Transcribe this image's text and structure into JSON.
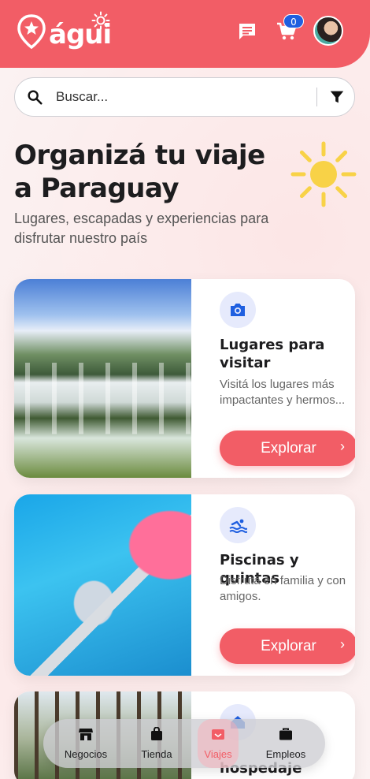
{
  "app": {
    "logo_text": "águi"
  },
  "header": {
    "cart_count": "0"
  },
  "search": {
    "placeholder": "Buscar..."
  },
  "hero": {
    "title": "Organizá tu viaje a Paraguay",
    "subtitle": "Lugares, escapadas y experiencias para disfrutar nuestro país"
  },
  "cards": [
    {
      "icon": "camera-icon",
      "title": "Lugares para visitar",
      "description": "Visitá los lugares más impactantes y hermos...",
      "button": "Explorar"
    },
    {
      "icon": "swimming-icon",
      "title": "Piscinas y quintas",
      "description": "Disfrutá en familia y con amigos.",
      "button": "Explorar"
    },
    {
      "icon": "lodging-icon",
      "title": "hospedaje"
    }
  ],
  "bottom_nav": {
    "items": [
      {
        "label": "Negocios",
        "icon": "store-icon"
      },
      {
        "label": "Tienda",
        "icon": "shopping-bag-icon"
      },
      {
        "label": "Viajes",
        "icon": "luggage-icon",
        "active": true
      },
      {
        "label": "Empleos",
        "icon": "briefcase-icon"
      }
    ]
  },
  "colors": {
    "brand": "#f25d66",
    "accent_blue": "#1f5fe0",
    "sun": "#f8d247"
  }
}
